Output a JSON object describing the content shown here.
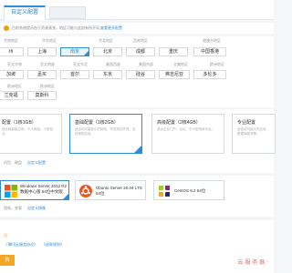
{
  "header": {
    "tab_label": "自定义配置"
  },
  "notice": {
    "text": "目前系统提示由于资源紧张，地区可能与此前有所不同，",
    "link": "查看更多配置"
  },
  "region": {
    "col_titles": [
      "华南地区",
      "华东地区",
      "华北地区",
      "西南地区",
      "港澳台地区"
    ],
    "row1": [
      "州",
      "上海",
      "南京",
      "北京",
      "成都",
      "重庆",
      "中国香港"
    ],
    "selected": "南京",
    "col_titles_2": [
      "亚太东南",
      "亚太南部",
      "亚太东北",
      "美国西部",
      "美国东部",
      "北美地区",
      "欧洲地区"
    ],
    "row2": [
      "加坡",
      "孟买",
      "首尔",
      "东京",
      "硅谷",
      "弗吉尼亚",
      "多伦多"
    ],
    "col_titles_3": [
      "欧洲地区",
      "欧洲地区"
    ],
    "row3": [
      "兰克福",
      "莫斯科"
    ]
  },
  "configs": [
    {
      "title": "配置（1核1GB）",
      "desc": "适合轻量级应用，个人网站、小型站点。",
      "selected": false
    },
    {
      "title": "基础配置（1核2GB）",
      "desc": "适合访问量较小的网站、开发测试环境，支持常规应用。",
      "selected": true
    },
    {
      "title": "高级配置（2核4GB）",
      "desc": "适合企业门户、论坛、中小型电商平台。",
      "selected": false
    },
    {
      "title": "专业配置",
      "desc": "适合访问量大的应用，数据库服务等。",
      "selected": false
    }
  ],
  "config_links": {
    "muted": "机型、硬盘",
    "link": "自定义配置"
  },
  "os": [
    {
      "label": "Windows Server 2012 R2 数据中心版 64位中文版",
      "selected": true,
      "icon": "windows-icon"
    },
    {
      "label": "Ubuntu Server 20.04 LTS 64位",
      "selected": false,
      "icon": "ubuntu-icon"
    },
    {
      "label": "CentOS 8.2 64位",
      "selected": false,
      "icon": "centos-icon"
    }
  ],
  "os_links": {
    "muted": "镜像，查看",
    "link": "自定义镜像"
  },
  "footer": {
    "line1": "元",
    "agree_prefix": "《",
    "agree_link1": "腾讯云服务协议》",
    "agree_link2": "《退款规则》"
  },
  "buy_button": "购",
  "watermark": "云 服 务 器 ·"
}
